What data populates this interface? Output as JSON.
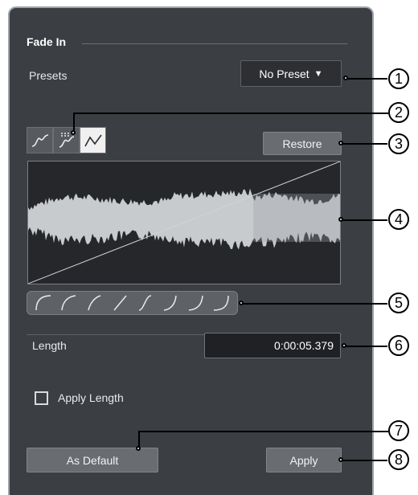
{
  "panel": {
    "section_title": "Fade In",
    "presets_label": "Presets",
    "preset_value": "No Preset",
    "preset_arrow": "▼",
    "restore_label": "Restore",
    "length_label": "Length",
    "length_value": "0:00:05.379",
    "apply_length_label": "Apply Length",
    "apply_length_checked": false,
    "as_default_label": "As Default",
    "apply_label": "Apply"
  },
  "fade_buttons": [
    {
      "icon": "s-curve-fade-icon",
      "active": false
    },
    {
      "icon": "dithered-fade-icon",
      "active": false
    },
    {
      "icon": "linear-fade-icon",
      "active": true
    }
  ],
  "curve_presets": [
    {
      "icon": "curve-preset-1-icon"
    },
    {
      "icon": "curve-preset-2-icon"
    },
    {
      "icon": "curve-preset-3-icon"
    },
    {
      "icon": "curve-preset-4-icon"
    },
    {
      "icon": "curve-preset-5-icon"
    },
    {
      "icon": "curve-preset-6-icon"
    },
    {
      "icon": "curve-preset-7-icon"
    },
    {
      "icon": "curve-preset-8-icon"
    }
  ],
  "callouts": [
    "1",
    "2",
    "3",
    "4",
    "5",
    "6",
    "7",
    "8"
  ],
  "colors": {
    "panel_bg": "#3b3e42",
    "button_bg": "#696d72",
    "field_bg": "#1f2124",
    "waveform": "#c8cbce",
    "waveform_tail": "#9a9ea2"
  }
}
